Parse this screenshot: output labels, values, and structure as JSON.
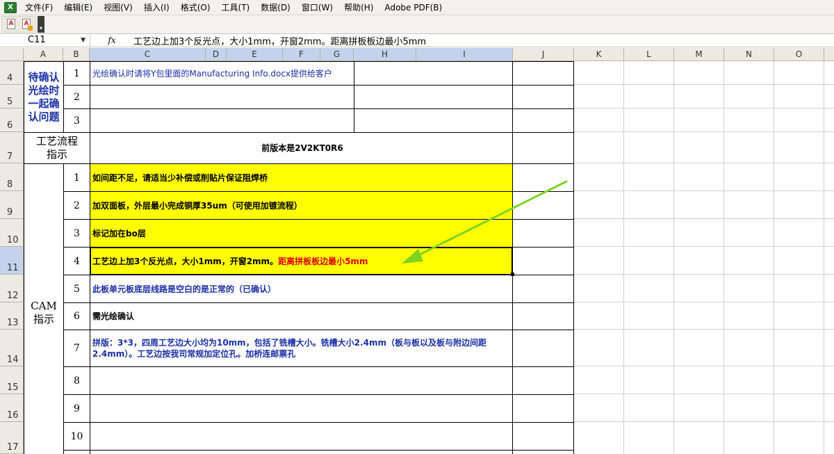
{
  "menu": {
    "items": [
      "文件(F)",
      "编辑(E)",
      "视图(V)",
      "插入(I)",
      "格式(O)",
      "工具(T)",
      "数据(D)",
      "窗口(W)",
      "帮助(H)",
      "Adobe PDF(B)"
    ]
  },
  "formula_bar": {
    "name_box": "C11",
    "fx": "fx",
    "content": "工艺边上加3个反光点，大小1mm，开窗2mm。距离拼板板边最小5mm"
  },
  "columns": [
    "A",
    "B",
    "C",
    "D",
    "E",
    "F",
    "G",
    "H",
    "I",
    "J",
    "K",
    "L",
    "M",
    "N",
    "O"
  ],
  "rows": [
    "4",
    "5",
    "6",
    "7",
    "8",
    "9",
    "10",
    "11",
    "12",
    "13",
    "14",
    "15",
    "16",
    "17"
  ],
  "sheet": {
    "confirm_label": "待确认光绘时一起确认问题",
    "confirm_items": [
      {
        "no": "1",
        "text": "光绘确认时请将Y包里面的Manufacturing Info.docx提供给客户"
      },
      {
        "no": "2",
        "text": ""
      },
      {
        "no": "3",
        "text": ""
      }
    ],
    "process_label": "工艺流程指示",
    "process_text": "前版本是2V2KT0R6",
    "cam_label": "CAM指示",
    "cam_items": [
      {
        "no": "1",
        "text": "如间距不足，请适当少补偿或削贴片保证阻焊桥"
      },
      {
        "no": "2",
        "text": "加双面板，外层最小完成铜厚35um（可使用加镀流程）"
      },
      {
        "no": "3",
        "text": "标记加在bo层"
      },
      {
        "no": "4",
        "text": "工艺边上加3个反光点，大小1mm，开窗2mm。",
        "text_red": "距离拼板板边最小5mm"
      },
      {
        "no": "5",
        "text": "此板单元板底层线路是空白的是正常的（已确认）"
      },
      {
        "no": "6",
        "text": "需光绘确认"
      },
      {
        "no": "7",
        "text": "拼版：3*3，四周工艺边大小均为10mm，包括了铣槽大小。铣槽大小2.4mm（板与板以及板与附边间距2.4mm）。工艺边按我司常规加定位孔。加桥连邮票孔"
      },
      {
        "no": "8",
        "text": ""
      },
      {
        "no": "9",
        "text": ""
      },
      {
        "no": "10",
        "text": ""
      }
    ]
  },
  "colors": {
    "highlight": "#ffff00",
    "text_blue": "#1a2ea8",
    "text_red": "#e00000",
    "arrow": "#7ed321"
  }
}
